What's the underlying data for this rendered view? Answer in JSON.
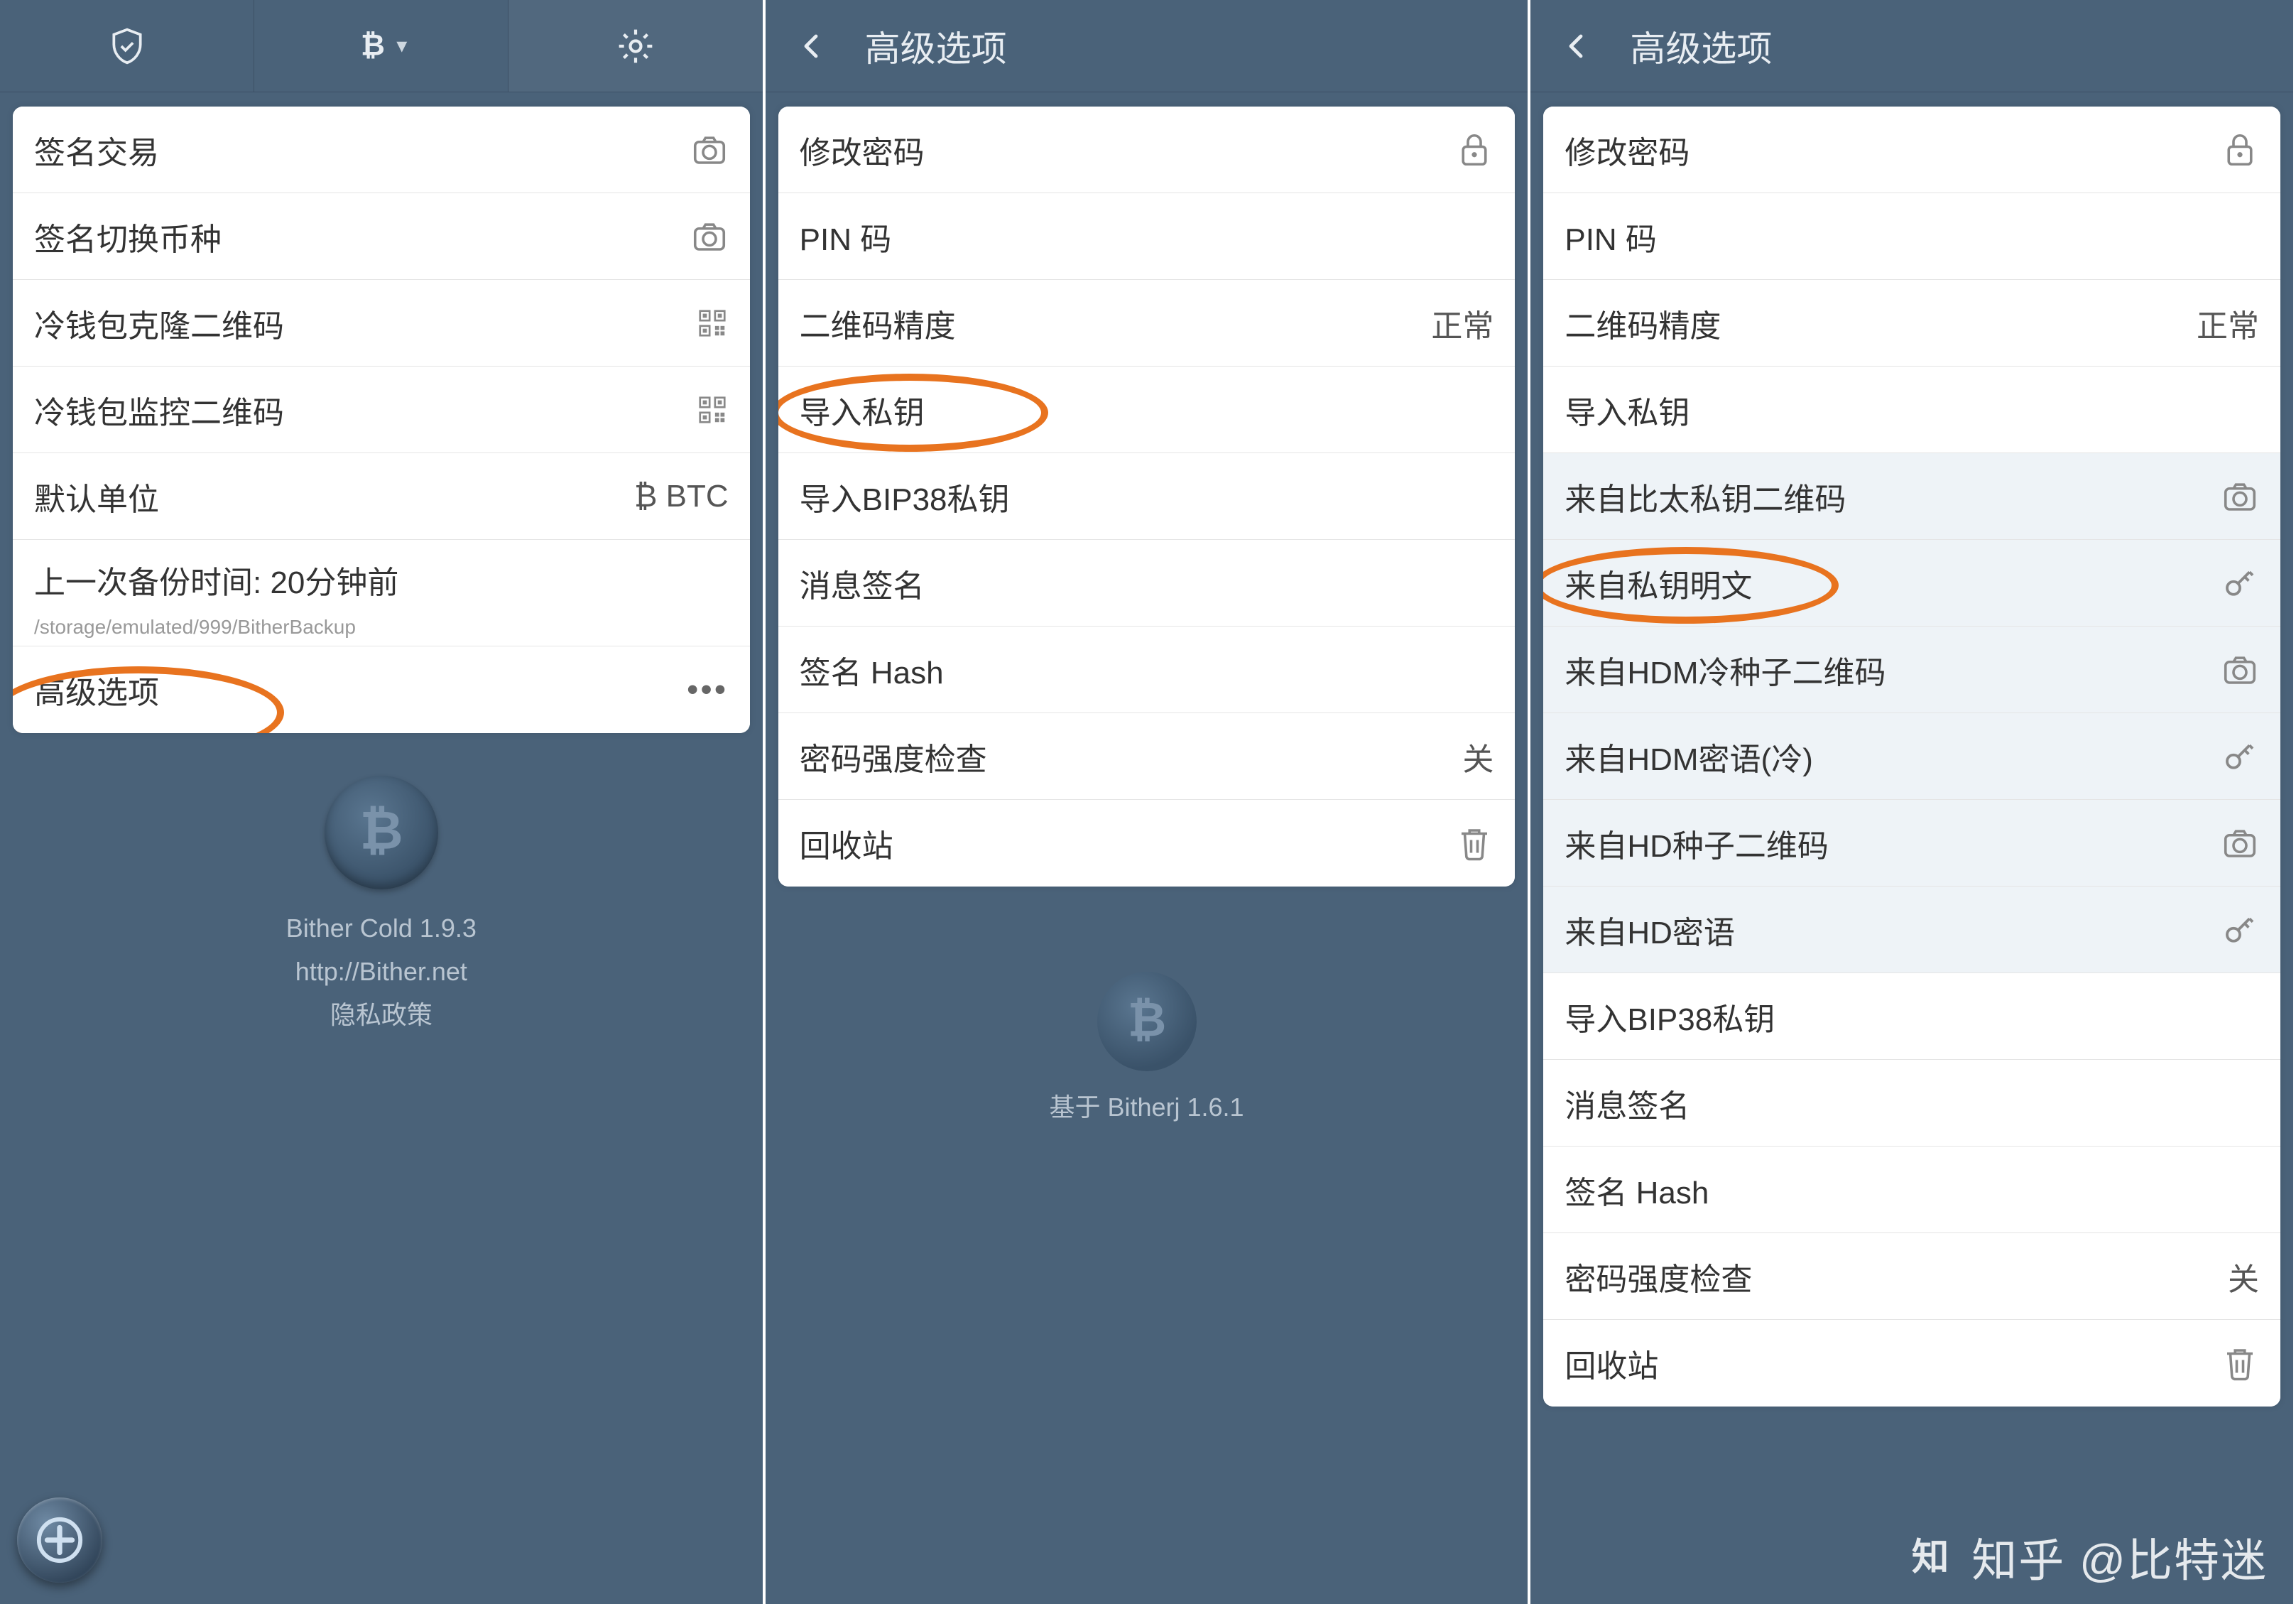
{
  "colors": {
    "bg": "#4a6279",
    "highlight": "#e8731f"
  },
  "watermark": "知乎 @比特迷",
  "screen1": {
    "rows": [
      {
        "label": "签名交易",
        "icon": "camera"
      },
      {
        "label": "签名切换币种",
        "icon": "camera"
      },
      {
        "label": "冷钱包克隆二维码",
        "icon": "qr"
      },
      {
        "label": "冷钱包监控二维码",
        "icon": "qr"
      },
      {
        "label": "默认单位",
        "value": "₿ BTC"
      },
      {
        "label": "上一次备份时间: 20分钟前",
        "sublabel": "/storage/emulated/999/BitherBackup"
      },
      {
        "label": "高级选项",
        "icon": "dots",
        "highlighted": true
      }
    ],
    "footer": {
      "app": "Bither Cold 1.9.3",
      "url": "http://Bither.net",
      "privacy": "隐私政策"
    }
  },
  "screen2": {
    "title": "高级选项",
    "rows": [
      {
        "label": "修改密码",
        "icon": "lock"
      },
      {
        "label": "PIN 码"
      },
      {
        "label": "二维码精度",
        "value": "正常"
      },
      {
        "label": "导入私钥",
        "highlighted": true
      },
      {
        "label": "导入BIP38私钥"
      },
      {
        "label": "消息签名"
      },
      {
        "label": "签名 Hash"
      },
      {
        "label": "密码强度检查",
        "value": "关"
      },
      {
        "label": "回收站",
        "icon": "trash"
      }
    ],
    "footer": "基于 Bitherj 1.6.1"
  },
  "screen3": {
    "title": "高级选项",
    "rows": [
      {
        "label": "修改密码",
        "icon": "lock"
      },
      {
        "label": "PIN 码"
      },
      {
        "label": "二维码精度",
        "value": "正常"
      },
      {
        "label": "导入私钥"
      },
      {
        "label": "来自比太私钥二维码",
        "icon": "camera",
        "sub": true
      },
      {
        "label": "来自私钥明文",
        "icon": "key",
        "sub": true,
        "highlighted": true
      },
      {
        "label": "来自HDM冷种子二维码",
        "icon": "camera",
        "sub": true
      },
      {
        "label": "来自HDM密语(冷)",
        "icon": "key",
        "sub": true
      },
      {
        "label": "来自HD种子二维码",
        "icon": "camera",
        "sub": true
      },
      {
        "label": "来自HD密语",
        "icon": "key",
        "sub": true
      },
      {
        "label": "导入BIP38私钥"
      },
      {
        "label": "消息签名"
      },
      {
        "label": "签名 Hash"
      },
      {
        "label": "密码强度检查",
        "value": "关"
      },
      {
        "label": "回收站",
        "icon": "trash"
      }
    ]
  }
}
